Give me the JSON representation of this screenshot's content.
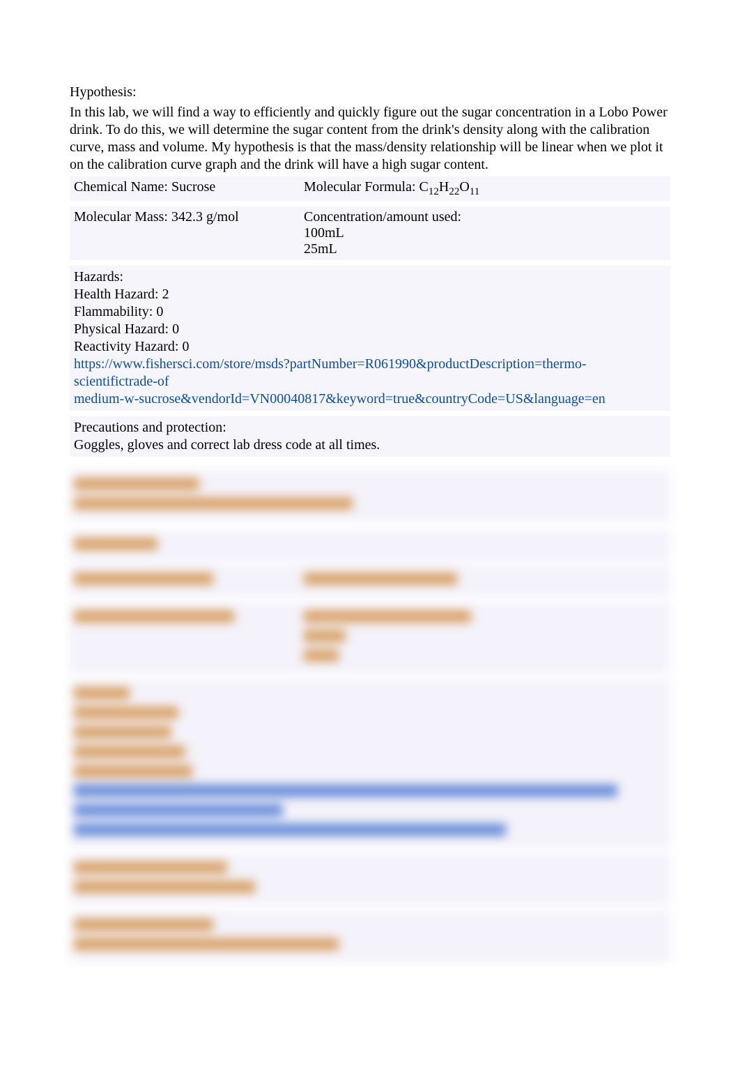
{
  "hypothesis": {
    "heading": "Hypothesis:",
    "body": "In this lab, we will find a way to efficiently and quickly figure out the sugar concentration in a Lobo Power drink. To do this, we will determine the sugar content from the drink's density along with the calibration curve, mass and volume. My hypothesis is that the mass/density relationship will be linear when we plot it on the calibration curve graph and the drink will have a high sugar content."
  },
  "chemical1": {
    "name_label": "Chemical Name: Sucrose",
    "formula_label": "Molecular Formula: ",
    "formula_base": "C",
    "formula_sub1": "12",
    "formula_mid1": "H",
    "formula_sub2": "22",
    "formula_mid2": "O",
    "formula_sub3": "11",
    "mass_label": "Molecular Mass: 342.3 g/mol",
    "conc_label": "Concentration/amount used:",
    "conc_line1": "100mL",
    "conc_line2": "25mL",
    "hazards_heading": "Hazards:",
    "hazard_health": "Health Hazard: 2",
    "hazard_flam": "Flammability: 0",
    "hazard_phys": "Physical Hazard: 0",
    "hazard_react": "Reactivity Hazard: 0",
    "link_line1": "https://www.fishersci.com/store/msds?partNumber=R061990&productDescription=thermo-scientifictrade-of",
    "link_line2": "medium-w-sucrose&vendorId=VN00040817&keyword=true&countryCode=US&language=en",
    "precautions_heading": "Precautions and protection:",
    "precautions_body": "Goggles, gloves and correct lab dress code at all times."
  }
}
